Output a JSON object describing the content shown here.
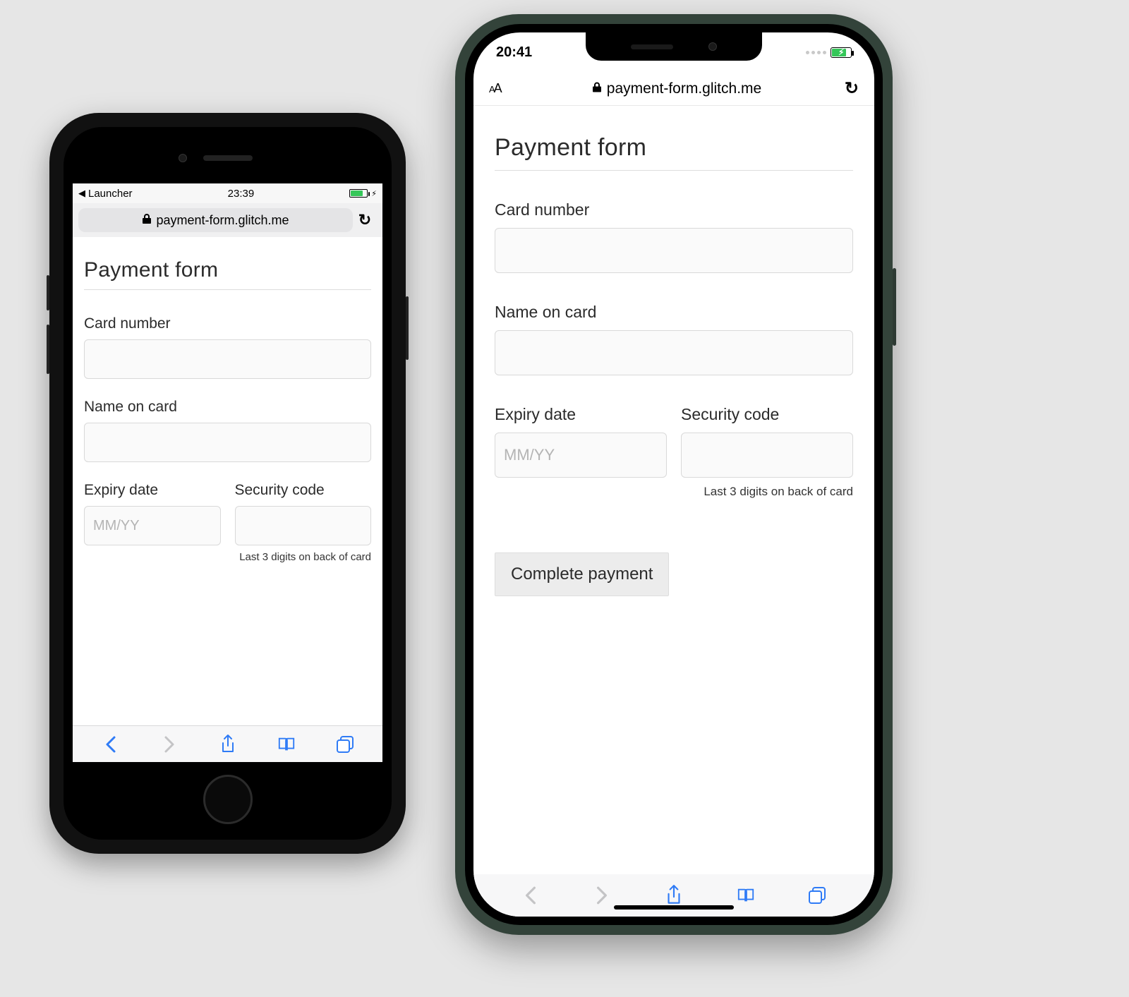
{
  "left": {
    "statusbar": {
      "back_app": "Launcher",
      "time": "23:39"
    },
    "urlbar": {
      "host": "payment-form.glitch.me"
    },
    "page": {
      "title": "Payment form",
      "card_number_label": "Card number",
      "name_label": "Name on card",
      "expiry_label": "Expiry date",
      "expiry_placeholder": "MM/YY",
      "cvc_label": "Security code",
      "cvc_hint": "Last 3 digits on back of card"
    }
  },
  "right": {
    "statusbar": {
      "time": "20:41"
    },
    "urlbar": {
      "host": "payment-form.glitch.me"
    },
    "page": {
      "title": "Payment form",
      "card_number_label": "Card number",
      "name_label": "Name on card",
      "expiry_label": "Expiry date",
      "expiry_placeholder": "MM/YY",
      "cvc_label": "Security code",
      "cvc_hint": "Last 3 digits on back of card",
      "submit_label": "Complete payment"
    }
  }
}
